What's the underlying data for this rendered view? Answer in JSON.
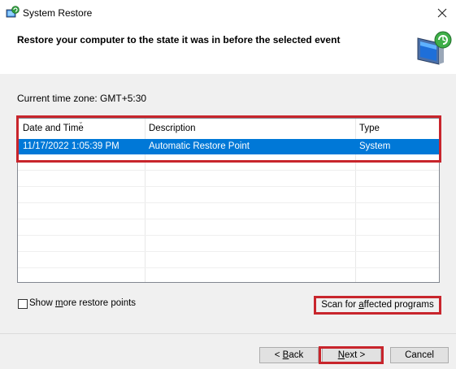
{
  "window": {
    "title": "System Restore"
  },
  "header": {
    "text": "Restore your computer to the state it was in before the selected event"
  },
  "timezone": {
    "label": "Current time zone: GMT+5:30"
  },
  "table": {
    "columns": [
      "Date and Time",
      "Description",
      "Type"
    ],
    "rows": [
      {
        "datetime": "11/17/2022 1:05:39 PM",
        "description": "Automatic Restore Point",
        "type": "System"
      }
    ]
  },
  "options": {
    "show_more_pre": "Show ",
    "show_more_key": "m",
    "show_more_post": "ore restore points",
    "scan_pre": "Scan for ",
    "scan_key": "a",
    "scan_post": "ffected programs"
  },
  "buttons": {
    "back_pre": "< ",
    "back_key": "B",
    "back_post": "ack",
    "next_key": "N",
    "next_post": "ext >",
    "cancel": "Cancel"
  },
  "colors": {
    "selection": "#0078d7",
    "highlight_box": "#c8252c"
  }
}
